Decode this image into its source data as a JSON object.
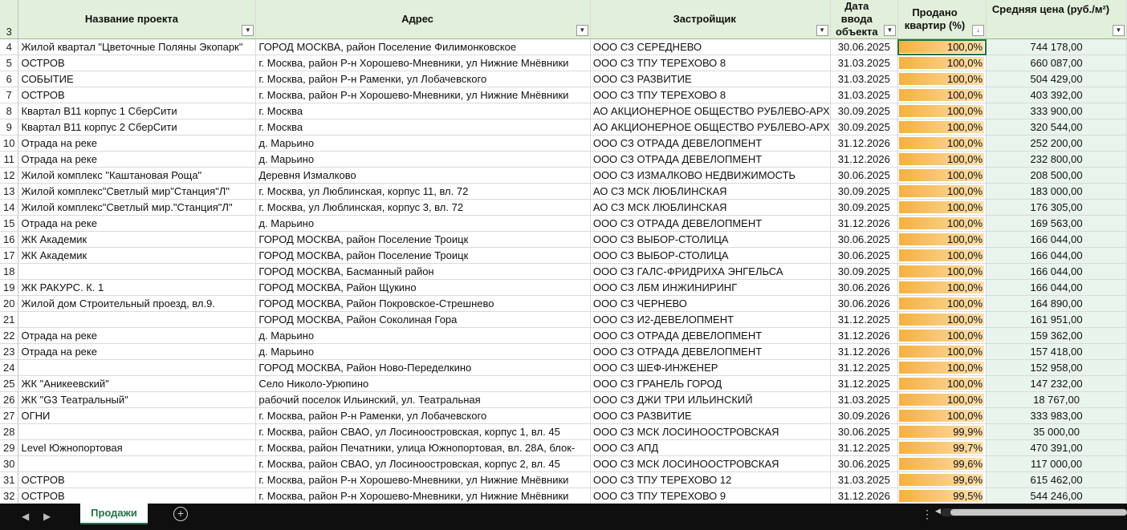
{
  "columns": {
    "header_row_number": "3",
    "name": "Название проекта",
    "address": "Адрес",
    "developer": "Застройщик",
    "date": "Дата ввода объекта",
    "sold": "Продано квартир (%)",
    "price": "Средняя цена (руб./м²)"
  },
  "rows": [
    {
      "n": "4",
      "name": "Жилой квартал \"Цветочные Поляны Экопарк\"",
      "address": "ГОРОД МОСКВА, район Поселение Филимонковское",
      "developer": "ООО СЗ СЕРЕДНЕВО",
      "date": "30.06.2025",
      "sold": "100,0%",
      "sold_value": 100.0,
      "price": "744 178,00"
    },
    {
      "n": "5",
      "name": "ОСТРОВ",
      "address": "г. Москва, район Р-н Хорошево-Мневники, ул Нижние Мнёвники",
      "developer": "ООО СЗ ТПУ ТЕРЕХОВО 8",
      "date": "31.03.2025",
      "sold": "100,0%",
      "sold_value": 100.0,
      "price": "660 087,00"
    },
    {
      "n": "6",
      "name": "СОБЫТИЕ",
      "address": "г. Москва, район Р-н Раменки, ул Лобачевского",
      "developer": "ООО СЗ РАЗВИТИЕ",
      "date": "31.03.2025",
      "sold": "100,0%",
      "sold_value": 100.0,
      "price": "504 429,00"
    },
    {
      "n": "7",
      "name": "ОСТРОВ",
      "address": "г. Москва, район Р-н Хорошево-Мневники, ул Нижние Мнёвники",
      "developer": "ООО СЗ ТПУ ТЕРЕХОВО 8",
      "date": "31.03.2025",
      "sold": "100,0%",
      "sold_value": 100.0,
      "price": "403 392,00"
    },
    {
      "n": "8",
      "name": "Квартал В11 корпус 1 СберСити",
      "address": "г. Москва",
      "developer": "АО АКЦИОНЕРНОЕ ОБЩЕСТВО РУБЛЕВО-АРХ",
      "date": "30.09.2025",
      "sold": "100,0%",
      "sold_value": 100.0,
      "price": "333 900,00"
    },
    {
      "n": "9",
      "name": "Квартал В11 корпус 2 СберСити",
      "address": "г. Москва",
      "developer": "АО АКЦИОНЕРНОЕ ОБЩЕСТВО РУБЛЕВО-АРХ",
      "date": "30.09.2025",
      "sold": "100,0%",
      "sold_value": 100.0,
      "price": "320 544,00"
    },
    {
      "n": "10",
      "name": "Отрада на реке",
      "address": "д. Марьино",
      "developer": "ООО СЗ ОТРАДА ДЕВЕЛОПМЕНТ",
      "date": "31.12.2026",
      "sold": "100,0%",
      "sold_value": 100.0,
      "price": "252 200,00"
    },
    {
      "n": "11",
      "name": "Отрада на реке",
      "address": "д. Марьино",
      "developer": "ООО СЗ ОТРАДА ДЕВЕЛОПМЕНТ",
      "date": "31.12.2026",
      "sold": "100,0%",
      "sold_value": 100.0,
      "price": "232 800,00"
    },
    {
      "n": "12",
      "name": "Жилой комплекс \"Каштановая Роща\"",
      "address": "Деревня Измалково",
      "developer": "ООО СЗ ИЗМАЛКОВО НЕДВИЖИМОСТЬ",
      "date": "30.06.2025",
      "sold": "100,0%",
      "sold_value": 100.0,
      "price": "208 500,00"
    },
    {
      "n": "13",
      "name": "Жилой комплекс\"Светлый мир\"Станция\"Л\"",
      "address": "г. Москва, ул Люблинская, корпус 11, вл. 72",
      "developer": "АО СЗ МСК ЛЮБЛИНСКАЯ",
      "date": "30.09.2025",
      "sold": "100,0%",
      "sold_value": 100.0,
      "price": "183 000,00"
    },
    {
      "n": "14",
      "name": "Жилой комплекс\"Светлый мир.\"Станция\"Л\"",
      "address": "г. Москва, ул Люблинская, корпус 3, вл. 72",
      "developer": "АО СЗ МСК ЛЮБЛИНСКАЯ",
      "date": "30.09.2025",
      "sold": "100,0%",
      "sold_value": 100.0,
      "price": "176 305,00"
    },
    {
      "n": "15",
      "name": "Отрада на реке",
      "address": "д. Марьино",
      "developer": "ООО СЗ ОТРАДА ДЕВЕЛОПМЕНТ",
      "date": "31.12.2026",
      "sold": "100,0%",
      "sold_value": 100.0,
      "price": "169 563,00"
    },
    {
      "n": "16",
      "name": "ЖК Академик",
      "address": "ГОРОД МОСКВА, район Поселение Троицк",
      "developer": "ООО СЗ ВЫБОР-СТОЛИЦА",
      "date": "30.06.2025",
      "sold": "100,0%",
      "sold_value": 100.0,
      "price": "166 044,00"
    },
    {
      "n": "17",
      "name": "ЖК Академик",
      "address": "ГОРОД МОСКВА, район Поселение Троицк",
      "developer": "ООО СЗ ВЫБОР-СТОЛИЦА",
      "date": "30.06.2025",
      "sold": "100,0%",
      "sold_value": 100.0,
      "price": "166 044,00"
    },
    {
      "n": "18",
      "name": "",
      "address": "ГОРОД МОСКВА, Басманный район",
      "developer": "ООО СЗ ГАЛС-ФРИДРИХА ЭНГЕЛЬСА",
      "date": "30.09.2025",
      "sold": "100,0%",
      "sold_value": 100.0,
      "price": "166 044,00"
    },
    {
      "n": "19",
      "name": "ЖК РАКУРС. К. 1",
      "address": "ГОРОД МОСКВА, Район Щукино",
      "developer": "ООО СЗ ЛБМ ИНЖИНИРИНГ",
      "date": "30.06.2026",
      "sold": "100,0%",
      "sold_value": 100.0,
      "price": "166 044,00"
    },
    {
      "n": "20",
      "name": "Жилой дом Строительный проезд, вл.9.",
      "address": "ГОРОД МОСКВА, Район Покровское-Стрешнево",
      "developer": "ООО СЗ ЧЕРНЕВО",
      "date": "30.06.2026",
      "sold": "100,0%",
      "sold_value": 100.0,
      "price": "164 890,00"
    },
    {
      "n": "21",
      "name": "",
      "address": "ГОРОД МОСКВА, Район Соколиная Гора",
      "developer": "ООО СЗ И2-ДЕВЕЛОПМЕНТ",
      "date": "31.12.2025",
      "sold": "100,0%",
      "sold_value": 100.0,
      "price": "161 951,00"
    },
    {
      "n": "22",
      "name": "Отрада на реке",
      "address": "д. Марьино",
      "developer": "ООО СЗ ОТРАДА ДЕВЕЛОПМЕНТ",
      "date": "31.12.2026",
      "sold": "100,0%",
      "sold_value": 100.0,
      "price": "159 362,00"
    },
    {
      "n": "23",
      "name": "Отрада на реке",
      "address": "д. Марьино",
      "developer": "ООО СЗ ОТРАДА ДЕВЕЛОПМЕНТ",
      "date": "31.12.2026",
      "sold": "100,0%",
      "sold_value": 100.0,
      "price": "157 418,00"
    },
    {
      "n": "24",
      "name": "",
      "address": "ГОРОД МОСКВА, Район Ново-Переделкино",
      "developer": "ООО СЗ ШЕФ-ИНЖЕНЕР",
      "date": "31.12.2025",
      "sold": "100,0%",
      "sold_value": 100.0,
      "price": "152 958,00"
    },
    {
      "n": "25",
      "name": "ЖК \"Аникеевский\"",
      "address": "Село Николо-Урюпино",
      "developer": "ООО СЗ ГРАНЕЛЬ ГОРОД",
      "date": "31.12.2025",
      "sold": "100,0%",
      "sold_value": 100.0,
      "price": "147 232,00"
    },
    {
      "n": "26",
      "name": "ЖК \"G3 Театральный\"",
      "address": "рабочий поселок Ильинский, ул. Театральная",
      "developer": "ООО СЗ ДЖИ ТРИ ИЛЬИНСКИЙ",
      "date": "31.03.2025",
      "sold": "100,0%",
      "sold_value": 100.0,
      "price": "18 767,00"
    },
    {
      "n": "27",
      "name": "ОГНИ",
      "address": "г. Москва, район Р-н Раменки, ул Лобачевского",
      "developer": "ООО СЗ РАЗВИТИЕ",
      "date": "30.09.2026",
      "sold": "100,0%",
      "sold_value": 100.0,
      "price": "333 983,00"
    },
    {
      "n": "28",
      "name": "",
      "address": "г. Москва, район СВАО, ул Лосиноостровская, корпус 1, вл. 45",
      "developer": "ООО СЗ МСК ЛОСИНООСТРОВСКАЯ",
      "date": "30.06.2025",
      "sold": "99,9%",
      "sold_value": 99.9,
      "price": "35 000,00"
    },
    {
      "n": "29",
      "name": "Level Южнопортовая",
      "address": "г. Москва, район Печатники, улица Южнопортовая, вл. 28А, блок-",
      "developer": "ООО СЗ АПД",
      "date": "31.12.2025",
      "sold": "99,7%",
      "sold_value": 99.7,
      "price": "470 391,00"
    },
    {
      "n": "30",
      "name": "",
      "address": "г. Москва, район СВАО, ул Лосиноостровская, корпус 2, вл. 45",
      "developer": "ООО СЗ МСК ЛОСИНООСТРОВСКАЯ",
      "date": "30.06.2025",
      "sold": "99,6%",
      "sold_value": 99.6,
      "price": "117 000,00"
    },
    {
      "n": "31",
      "name": "ОСТРОВ",
      "address": "г. Москва, район Р-н Хорошево-Мневники, ул Нижние Мнёвники",
      "developer": "ООО СЗ ТПУ ТЕРЕХОВО 12",
      "date": "31.03.2025",
      "sold": "99,6%",
      "sold_value": 99.6,
      "price": "615 462,00"
    },
    {
      "n": "32",
      "name": "ОСТРОВ",
      "address": "г. Москва, район Р-н Хорошево-Мневники, ул Нижние Мнёвники",
      "developer": "ООО СЗ ТПУ ТЕРЕХОВО 9",
      "date": "31.12.2026",
      "sold": "99,5%",
      "sold_value": 99.5,
      "price": "544 246,00"
    }
  ],
  "sheet_tabs": {
    "active": "Продажи",
    "prev_icon": "chevron-left-icon",
    "next_icon": "chevron-right-icon",
    "add_icon": "plus-circle-icon",
    "more_icon": "vertical-dots-icon"
  },
  "colors": {
    "header_bg": "#e2efda",
    "databar": "#f6b040",
    "price_bg": "#e8f4ec",
    "tab_accent": "#217346"
  }
}
